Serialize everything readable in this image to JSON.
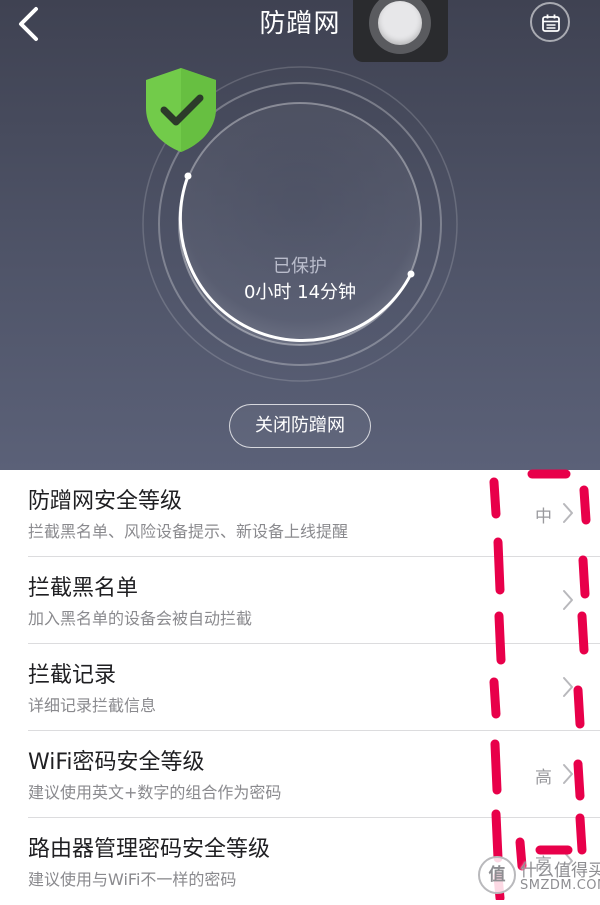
{
  "header": {
    "title": "防蹭网",
    "back_icon": "chevron-left-icon",
    "calendar_icon": "calendar-icon"
  },
  "protection": {
    "status_label": "已保护",
    "duration": "0小时 14分钟",
    "shield_icon": "shield-check-icon",
    "shield_color": "#72cb4a"
  },
  "close_button": {
    "label": "关闭防蹭网"
  },
  "settings": [
    {
      "title": "防蹭网安全等级",
      "subtitle": "拦截黑名单、风险设备提示、新设备上线提醒",
      "value": "中"
    },
    {
      "title": "拦截黑名单",
      "subtitle": "加入黑名单的设备会被自动拦截",
      "value": ""
    },
    {
      "title": "拦截记录",
      "subtitle": "详细记录拦截信息",
      "value": ""
    },
    {
      "title": "WiFi密码安全等级",
      "subtitle": "建议使用英文+数字的组合作为密码",
      "value": "高"
    },
    {
      "title": "路由器管理密码安全等级",
      "subtitle": "建议使用与WiFi不一样的密码",
      "value": "高"
    }
  ],
  "annotation": {
    "color": "#e8004a"
  },
  "watermark": {
    "logo_text": "值",
    "name": "什么值得买",
    "domain": "SMZDM.COM"
  }
}
